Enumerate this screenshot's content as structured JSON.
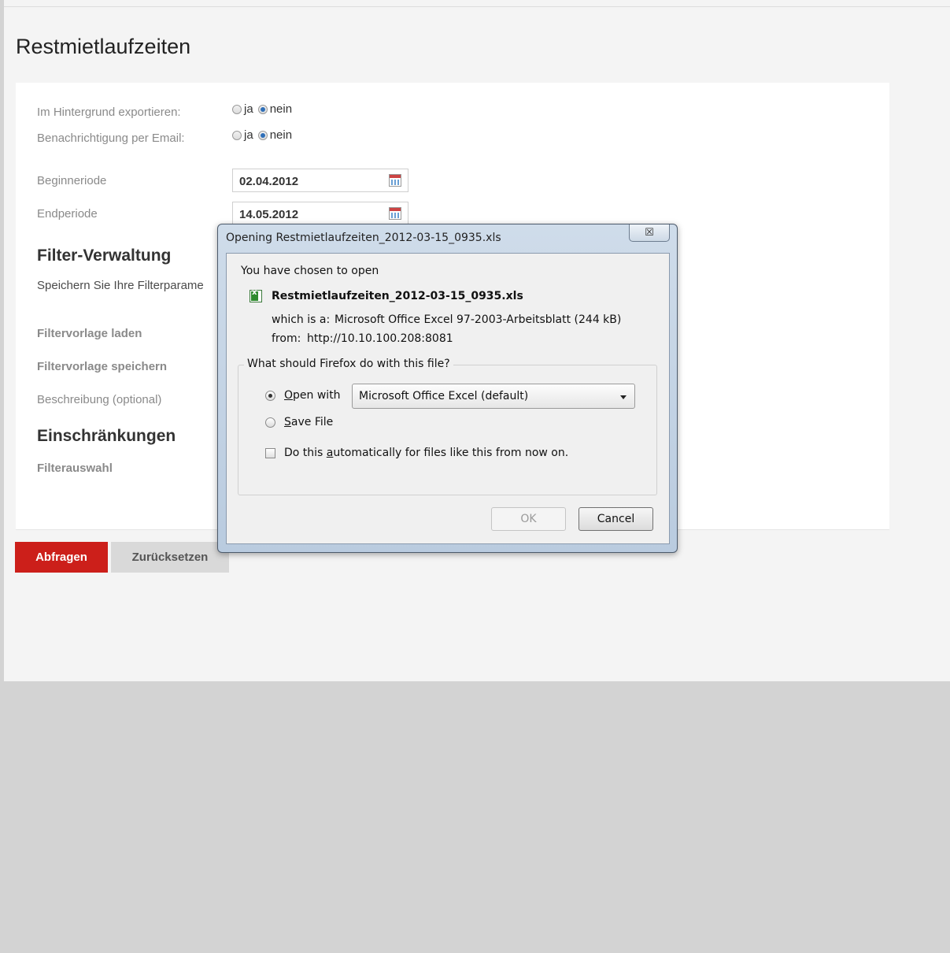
{
  "page": {
    "title": "Restmietlaufzeiten",
    "export_bg_label": "Im Hintergrund exportieren:",
    "email_label": "Benachrichtigung per Email:",
    "radio_yes": "ja",
    "radio_no": "nein",
    "begin_label": "Beginneriode",
    "begin_value": "02.04.2012",
    "end_label": "Endperiode",
    "end_value": "14.05.2012",
    "filter_section": "Filter-Verwaltung",
    "filter_desc": "Speichern Sie Ihre Filterparame",
    "load_template": "Filtervorlage laden",
    "save_template": "Filtervorlage speichern",
    "description_opt": "Beschreibung (optional)",
    "restrictions_section": "Einschränkungen",
    "filter_selection": "Filterauswahl",
    "query_button": "Abfragen",
    "reset_button": "Zurücksetzen"
  },
  "dialog": {
    "title": "Opening Restmietlaufzeiten_2012-03-15_0935.xls",
    "close_glyph": "☒",
    "intro": "You have chosen to open",
    "filename": "Restmietlaufzeiten_2012-03-15_0935.xls",
    "which_label": "which is a:",
    "which_value": "Microsoft Office Excel 97-2003-Arbeitsblatt (244 kB)",
    "from_label": "from:",
    "from_value": "http://10.10.100.208:8081",
    "legend": "What should Firefox do with this file?",
    "open_with_prefix": "O",
    "open_with_rest": "pen with",
    "open_with_app": "Microsoft Office Excel (default)",
    "save_prefix": "S",
    "save_rest": "ave File",
    "auto_prefix": "Do this ",
    "auto_underlined": "a",
    "auto_rest": "utomatically for files like this from now on.",
    "ok_label": "OK",
    "cancel_label": "Cancel"
  }
}
